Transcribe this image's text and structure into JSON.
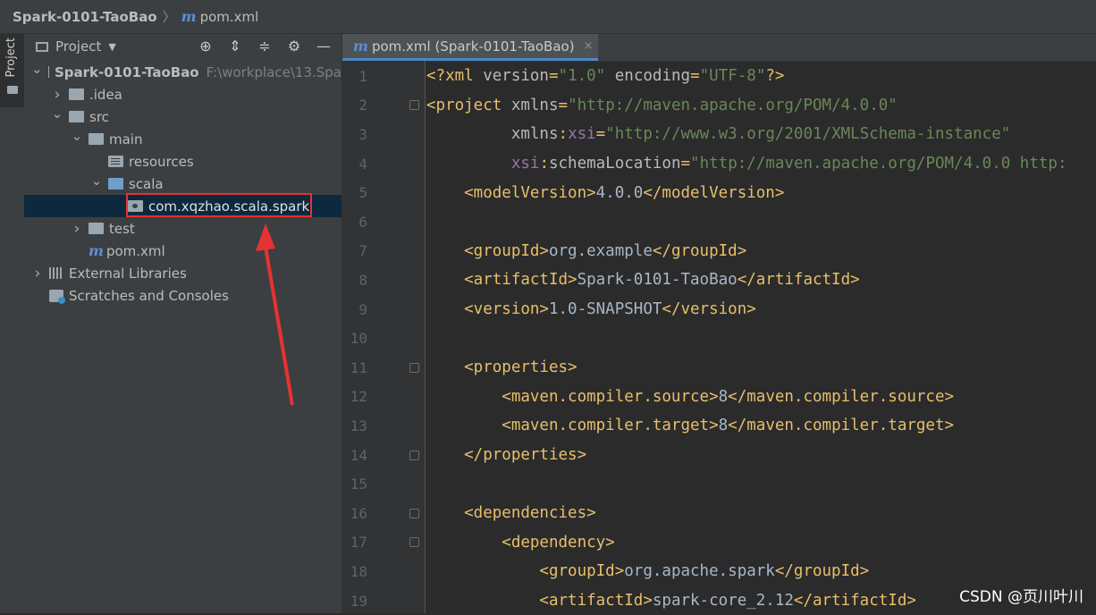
{
  "breadcrumb": {
    "project": "Spark-0101-TaoBao",
    "separator": "〉",
    "file_icon": "m",
    "file": "pom.xml"
  },
  "left_strip": {
    "tab_label": "Project"
  },
  "project_panel": {
    "title": "Project",
    "tools": [
      "locate-icon",
      "expand-all-icon",
      "collapse-all-icon",
      "gear-icon",
      "minimize-icon"
    ],
    "tree": [
      {
        "label": "Spark-0101-TaoBao",
        "path": "F:\\workplace\\13.Spa",
        "depth": 0,
        "expanded": true,
        "icon": "module-folder-icon",
        "bold": true
      },
      {
        "label": ".idea",
        "depth": 1,
        "expanded": false,
        "icon": "folder-icon"
      },
      {
        "label": "src",
        "depth": 1,
        "expanded": true,
        "icon": "folder-icon"
      },
      {
        "label": "main",
        "depth": 2,
        "expanded": true,
        "icon": "folder-icon"
      },
      {
        "label": "resources",
        "depth": 3,
        "icon": "resources-folder-icon"
      },
      {
        "label": "scala",
        "depth": 3,
        "expanded": true,
        "icon": "source-folder-icon"
      },
      {
        "label": "com.xqzhao.scala.spark",
        "depth": 4,
        "icon": "package-icon",
        "selected": true
      },
      {
        "label": "test",
        "depth": 2,
        "expanded": false,
        "icon": "folder-icon"
      },
      {
        "label": "pom.xml",
        "depth": 2,
        "icon": "maven-icon"
      },
      {
        "label": "External Libraries",
        "depth": 0,
        "expanded": false,
        "icon": "libraries-icon"
      },
      {
        "label": "Scratches and Consoles",
        "depth": 0,
        "icon": "scratches-icon"
      }
    ]
  },
  "editor": {
    "tab": {
      "icon": "m",
      "label": "pom.xml (Spark-0101-TaoBao)",
      "close": "×"
    },
    "lines": [
      {
        "n": "1",
        "parts": [
          [
            "t-tag",
            "<?xml "
          ],
          [
            "t-attr",
            "version"
          ],
          [
            "t-tag",
            "="
          ],
          [
            "t-val",
            "\"1.0\""
          ],
          [
            "t-tag",
            " "
          ],
          [
            "t-attr",
            "encoding"
          ],
          [
            "t-tag",
            "="
          ],
          [
            "t-val",
            "\"UTF-8\""
          ],
          [
            "t-tag",
            "?>"
          ]
        ]
      },
      {
        "n": "2",
        "parts": [
          [
            "t-tag",
            "<project "
          ],
          [
            "t-attr",
            "xmlns"
          ],
          [
            "t-tag",
            "="
          ],
          [
            "t-val",
            "\"http://maven.apache.org/POM/4.0.0\""
          ]
        ]
      },
      {
        "n": "3",
        "parts": [
          [
            "t-tag",
            "         "
          ],
          [
            "t-attr",
            "xmlns"
          ],
          [
            "t-tag",
            ":"
          ],
          [
            "t-ns",
            "xsi"
          ],
          [
            "t-tag",
            "="
          ],
          [
            "t-val",
            "\"http://www.w3.org/2001/XMLSchema-instance\""
          ]
        ]
      },
      {
        "n": "4",
        "parts": [
          [
            "t-tag",
            "         "
          ],
          [
            "t-ns",
            "xsi"
          ],
          [
            "t-tag",
            ":"
          ],
          [
            "t-attr",
            "schemaLocation"
          ],
          [
            "t-tag",
            "="
          ],
          [
            "t-val",
            "\"http://maven.apache.org/POM/4.0.0 http:"
          ]
        ]
      },
      {
        "n": "5",
        "parts": [
          [
            "t-tag",
            "    <modelVersion>"
          ],
          [
            "t-txt",
            "4.0.0"
          ],
          [
            "t-tag",
            "</modelVersion>"
          ]
        ]
      },
      {
        "n": "6",
        "parts": []
      },
      {
        "n": "7",
        "parts": [
          [
            "t-tag",
            "    <groupId>"
          ],
          [
            "t-txt",
            "org.example"
          ],
          [
            "t-tag",
            "</groupId>"
          ]
        ]
      },
      {
        "n": "8",
        "parts": [
          [
            "t-tag",
            "    <artifactId>"
          ],
          [
            "t-txt",
            "Spark-0101-TaoBao"
          ],
          [
            "t-tag",
            "</artifactId>"
          ]
        ]
      },
      {
        "n": "9",
        "parts": [
          [
            "t-tag",
            "    <version>"
          ],
          [
            "t-txt",
            "1.0-SNAPSHOT"
          ],
          [
            "t-tag",
            "</version>"
          ]
        ]
      },
      {
        "n": "10",
        "parts": []
      },
      {
        "n": "11",
        "parts": [
          [
            "t-tag",
            "    <properties>"
          ]
        ]
      },
      {
        "n": "12",
        "parts": [
          [
            "t-tag",
            "        <maven.compiler.source>"
          ],
          [
            "t-txt",
            "8"
          ],
          [
            "t-tag",
            "</maven.compiler.source>"
          ]
        ]
      },
      {
        "n": "13",
        "parts": [
          [
            "t-tag",
            "        <maven.compiler.target>"
          ],
          [
            "t-txt",
            "8"
          ],
          [
            "t-tag",
            "</maven.compiler.target>"
          ]
        ]
      },
      {
        "n": "14",
        "parts": [
          [
            "t-tag",
            "    </properties>"
          ]
        ]
      },
      {
        "n": "15",
        "parts": []
      },
      {
        "n": "16",
        "parts": [
          [
            "t-tag",
            "    <dependencies>"
          ]
        ]
      },
      {
        "n": "17",
        "parts": [
          [
            "t-tag",
            "        <dependency>"
          ]
        ]
      },
      {
        "n": "18",
        "parts": [
          [
            "t-tag",
            "            <groupId>"
          ],
          [
            "t-txt",
            "org.apache.spark"
          ],
          [
            "t-tag",
            "</groupId>"
          ]
        ]
      },
      {
        "n": "19",
        "parts": [
          [
            "t-tag",
            "            <artifactId>"
          ],
          [
            "t-txt",
            "spark-core_2.12"
          ],
          [
            "t-tag",
            "</artifactId>"
          ]
        ]
      }
    ]
  },
  "watermark": "CSDN @页川叶川",
  "colors": {
    "annotation": "#e63232",
    "accent": "#4a88c7"
  }
}
